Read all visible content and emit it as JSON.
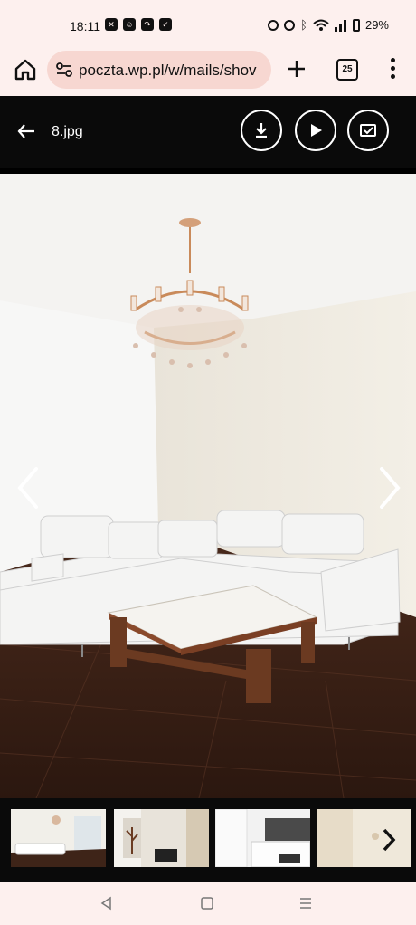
{
  "status_bar": {
    "time": "18:11",
    "battery_percent": "29%",
    "notification_icons": [
      "sim-icon",
      "smiley-icon",
      "missed-call-icon",
      "walk-icon"
    ],
    "system_icons": [
      "nfc-icon",
      "alarm-icon",
      "bluetooth-icon",
      "wifi-icon",
      "signal-icon",
      "battery-icon"
    ]
  },
  "browser": {
    "url": "poczta.wp.pl/w/mails/shov",
    "tab_count": "25"
  },
  "viewer": {
    "file_name": "8.jpg",
    "actions": [
      "download",
      "play-slideshow",
      "save-to-drive"
    ],
    "photo_description_icon": "living-room-photo"
  },
  "thumbnails": [
    {
      "subject": "living-room"
    },
    {
      "subject": "wall-decoration"
    },
    {
      "subject": "kitchen"
    },
    {
      "subject": "wallpaper"
    }
  ],
  "colors": {
    "browser_chrome": "#fdf0ee",
    "url_pill": "#f7d7d1",
    "viewer_bg": "#0a0a0a"
  }
}
